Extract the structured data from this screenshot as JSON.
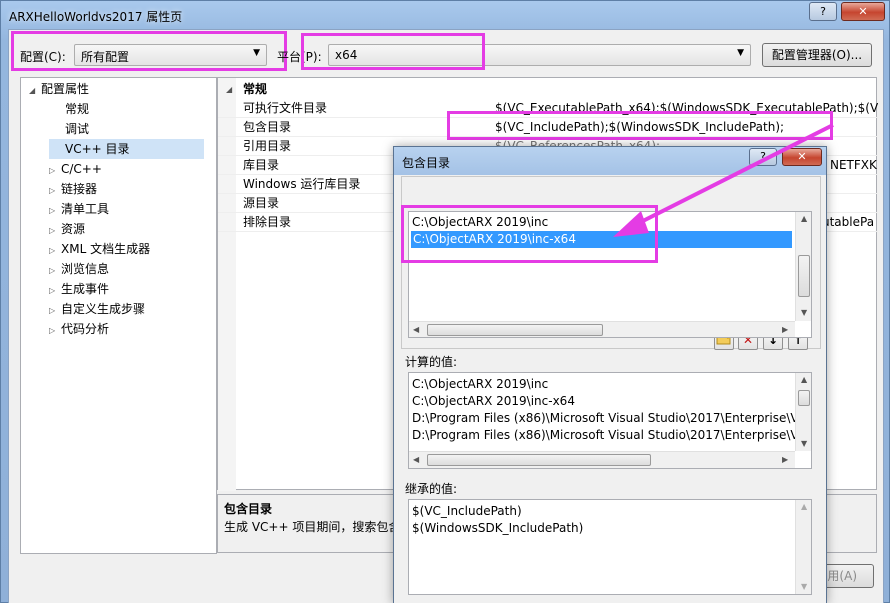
{
  "window": {
    "title": "ARXHelloWorldvs2017 属性页",
    "help_glyph": "?",
    "close_glyph": "✕"
  },
  "config_bar": {
    "config_label": "配置(C):",
    "config_value": "所有配置",
    "platform_label": "平台(P):",
    "platform_value": "x64",
    "manager_button": "配置管理器(O)..."
  },
  "tree": {
    "root": "配置属性",
    "items": [
      {
        "label": "常规",
        "expandable": false
      },
      {
        "label": "调试",
        "expandable": false
      },
      {
        "label": "VC++ 目录",
        "expandable": false,
        "selected": true
      },
      {
        "label": "C/C++",
        "expandable": true
      },
      {
        "label": "链接器",
        "expandable": true
      },
      {
        "label": "清单工具",
        "expandable": true
      },
      {
        "label": "资源",
        "expandable": true
      },
      {
        "label": "XML 文档生成器",
        "expandable": true
      },
      {
        "label": "浏览信息",
        "expandable": true
      },
      {
        "label": "生成事件",
        "expandable": true
      },
      {
        "label": "自定义生成步骤",
        "expandable": true
      },
      {
        "label": "代码分析",
        "expandable": true
      }
    ]
  },
  "grid": {
    "section": "常规",
    "rows": [
      {
        "name": "可执行文件目录",
        "value": "$(VC_ExecutablePath_x64);$(WindowsSDK_ExecutablePath);$(VS_E"
      },
      {
        "name": "包含目录",
        "value": "$(VC_IncludePath);$(WindowsSDK_IncludePath);"
      },
      {
        "name": "引用目录",
        "value": "$(VC_ReferencesPath_x64);"
      },
      {
        "name": "库目录",
        "value": "NETFXK"
      },
      {
        "name": "Windows 运行库目录",
        "value": ""
      },
      {
        "name": "源目录",
        "value": ""
      },
      {
        "name": "排除目录",
        "value": "utablePa"
      }
    ]
  },
  "description": {
    "title": "包含目录",
    "text": "生成 VC++ 项目期间，搜索包含"
  },
  "apply_button": "用(A)",
  "dialog": {
    "title": "包含目录",
    "help_glyph": "?",
    "close_glyph": "✕",
    "toolbar": {
      "new_line": "新行",
      "delete": "✕",
      "move_down": "↓",
      "move_up": "↑"
    },
    "entries": [
      "C:\\ObjectARX 2019\\inc",
      "C:\\ObjectARX 2019\\inc-x64"
    ],
    "computed_label": "计算的值:",
    "computed_values": [
      "C:\\ObjectARX 2019\\inc",
      "C:\\ObjectARX 2019\\inc-x64",
      "D:\\Program Files (x86)\\Microsoft Visual Studio\\2017\\Enterprise\\V",
      "D:\\Program Files (x86)\\Microsoft Visual Studio\\2017\\Enterprise\\V"
    ],
    "inherited_label": "继承的值:",
    "inherited_values": [
      "$(VC_IncludePath)",
      "$(WindowsSDK_IncludePath)"
    ]
  },
  "colors": {
    "highlight": "#e43ce4",
    "selection": "#3399ff"
  }
}
